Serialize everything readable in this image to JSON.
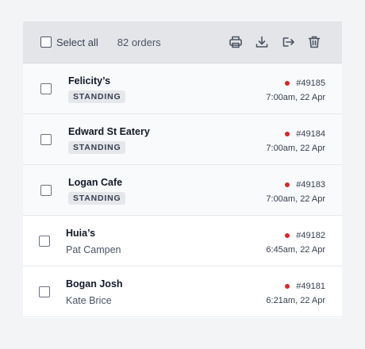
{
  "toolbar": {
    "select_all_label": "Select all",
    "order_count": "82 orders",
    "icons": [
      "print-icon",
      "download-icon",
      "export-icon",
      "trash-icon"
    ]
  },
  "colors": {
    "status_dot": "#dc2626",
    "toolbar_bg": "#e4e5e9",
    "badge_bg": "#e5e7eb"
  },
  "orders": [
    {
      "name": "Felicity’s",
      "badge": "STANDING",
      "order_no": "#49185",
      "time": "7:00am, 22 Apr"
    },
    {
      "name": "Edward St Eatery",
      "badge": "STANDING",
      "order_no": "#49184",
      "time": "7:00am, 22 Apr"
    },
    {
      "name": "Logan Cafe",
      "badge": "STANDING",
      "order_no": "#49183",
      "time": "7:00am, 22 Apr"
    },
    {
      "name": "Huia’s",
      "contact": "Pat Campen",
      "order_no": "#49182",
      "time": "6:45am, 22 Apr"
    },
    {
      "name": "Bogan Josh",
      "contact": "Kate Brice",
      "order_no": "#49181",
      "time": "6:21am, 22 Apr"
    }
  ]
}
